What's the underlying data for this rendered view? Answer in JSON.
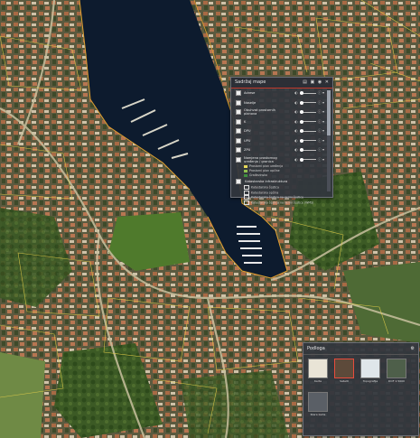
{
  "layers_panel": {
    "title": "Sadržaj mape",
    "header_icons": [
      "layer-list-icon",
      "folder-icon",
      "eye-icon",
      "close-icon"
    ],
    "rows": [
      {
        "label": "Adrese"
      },
      {
        "label": "Naselje"
      },
      {
        "label": "Obuhvat prostornih planova"
      },
      {
        "label": "K"
      },
      {
        "label": "DPU"
      },
      {
        "label": "UPU"
      },
      {
        "label": "ZPU"
      },
      {
        "label": "Namjena prostornog uređenja / granica"
      }
    ],
    "sub_items": [
      "Prostorni plan uređenja",
      "Prostorni plan općine",
      "Građevinsko"
    ],
    "group_label": "Katastarska infrastruktura",
    "group_items": [
      "Katastarska čestica",
      "Katastarska općina",
      "Katastarska čestica na razini čestice",
      "Katastarska čestica na razini čestice (WMS)"
    ]
  },
  "basemap_panel": {
    "title": "Podloga",
    "tiles": [
      {
        "label": "Karta",
        "selected": false
      },
      {
        "label": "Satelit",
        "selected": true
      },
      {
        "label": "Topografija",
        "selected": false
      },
      {
        "label": "DOF 1:5000",
        "selected": false
      },
      {
        "label": "Stara karta",
        "selected": false
      }
    ]
  }
}
